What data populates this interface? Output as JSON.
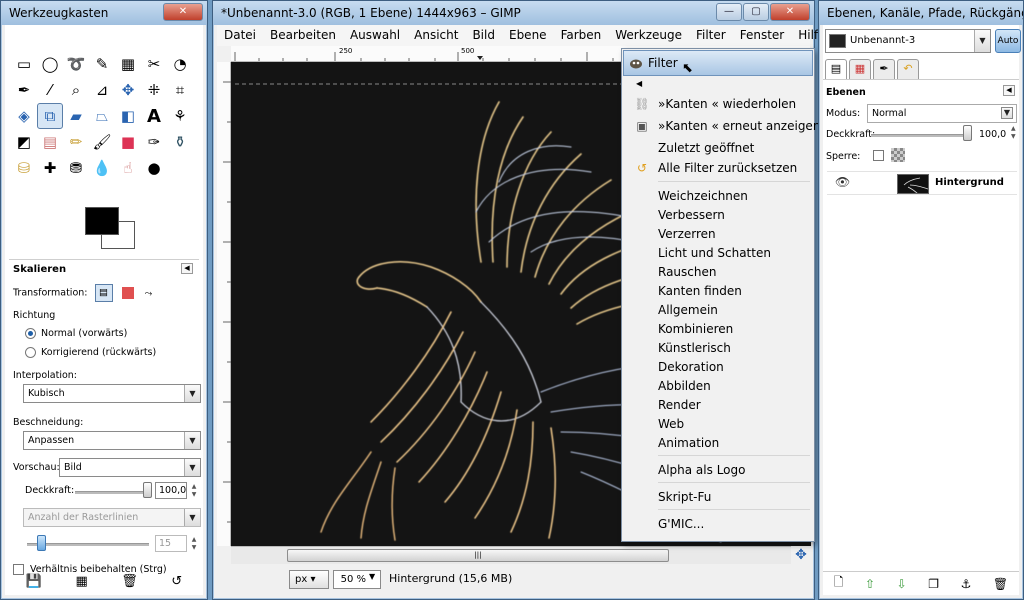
{
  "toolbox": {
    "title": "Werkzeugkasten",
    "tools": [
      "rect-select",
      "ellipse-select",
      "free-select",
      "fuzzy-select",
      "color-select",
      "scissors",
      "foreground-select",
      "paths",
      "color-picker",
      "zoom",
      "measure",
      "move",
      "align",
      "crop",
      "rotate",
      "scale",
      "shear",
      "perspective",
      "flip",
      "text",
      "cage",
      "bucket-fill",
      "blend",
      "pencil",
      "paintbrush",
      "eraser",
      "airbrush",
      "ink",
      "clone",
      "heal",
      "perspective-clone",
      "blur",
      "smudge",
      "dodge-burn"
    ],
    "options_title": "Skalieren",
    "transformation_label": "Transformation:",
    "direction_label": "Richtung",
    "direction_normal": "Normal (vorwärts)",
    "direction_corrective": "Korrigierend (rückwärts)",
    "interpolation_label": "Interpolation:",
    "interpolation_value": "Kubisch",
    "clipping_label": "Beschneidung:",
    "clipping_value": "Anpassen",
    "preview_label": "Vorschau:",
    "preview_value": "Bild",
    "opacity_label": "Deckkraft:",
    "opacity_value": "100,0",
    "grid_value": "Anzahl der Rasterlinien",
    "grid_count": "15",
    "keep_aspect": "Verhältnis beibehalten (Strg)"
  },
  "main": {
    "title": "*Unbenannt-3.0 (RGB, 1 Ebene) 1444x963 – GIMP",
    "menus": [
      "Datei",
      "Bearbeiten",
      "Auswahl",
      "Ansicht",
      "Bild",
      "Ebene",
      "Farben",
      "Werkzeuge",
      "Filter",
      "Fenster",
      "Hilfe"
    ],
    "ruler_labels": [
      "250",
      "500"
    ],
    "unit": "px",
    "zoom": "50 %",
    "status": "Hintergrund (15,6 MB)"
  },
  "filter_menu": {
    "title": "Filter",
    "repeat": "»Kanten « wiederholen",
    "reshow": "»Kanten « erneut anzeigen",
    "recent": "Zuletzt geöffnet",
    "reset": "Alle Filter zurücksetzen",
    "items": [
      "Weichzeichnen",
      "Verbessern",
      "Verzerren",
      "Licht und Schatten",
      "Rauschen",
      "Kanten finden",
      "Allgemein",
      "Kombinieren",
      "Künstlerisch",
      "Dekoration",
      "Abbilden",
      "Render",
      "Web",
      "Animation"
    ],
    "alpha_logo": "Alpha als Logo",
    "script_fu": "Skript-Fu",
    "gmic": "G'MIC..."
  },
  "layers": {
    "title": "Ebenen, Kanäle, Pfade, Rückgäng...",
    "image": "Unbenannt-3",
    "auto": "Auto",
    "panel_title": "Ebenen",
    "mode_label": "Modus:",
    "mode_value": "Normal",
    "opacity_label": "Deckkraft:",
    "opacity_value": "100,0",
    "lock_label": "Sperre:",
    "layer_name": "Hintergrund"
  },
  "colors": {
    "accent": "#1e5fa8",
    "canvas_bg": "#161616",
    "titlebar": "#a9c6e4"
  }
}
